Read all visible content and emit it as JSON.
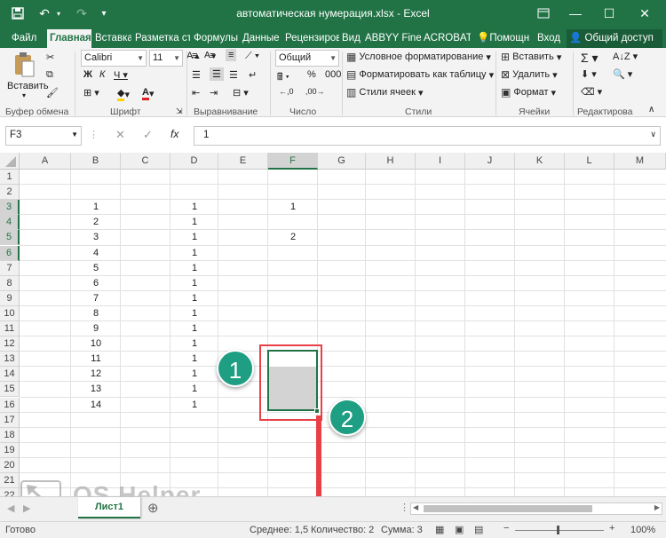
{
  "title": "автоматическая нумерация.xlsx - Excel",
  "tabs": [
    "Файл",
    "Главная",
    "Вставка",
    "Разметка стр",
    "Формулы",
    "Данные",
    "Рецензиров",
    "Вид",
    "ABBYY FineR",
    "ACROBAT",
    "Помощн",
    "Вход",
    "Общий доступ"
  ],
  "ribbon": {
    "paste": "Вставить",
    "font_name": "Calibri",
    "font_size": "11",
    "number_format": "Общий",
    "cond_format": "Условное форматирование",
    "format_table": "Форматировать как таблицу",
    "cell_styles": "Стили ячеек",
    "insert": "Вставить",
    "delete": "Удалить",
    "format": "Формат",
    "groups": [
      "Буфер обмена",
      "Шрифт",
      "Выравнивание",
      "Число",
      "Стили",
      "Ячейки",
      "Редактирова"
    ]
  },
  "formula_bar": {
    "name_box": "F3",
    "formula": "1"
  },
  "columns": [
    "A",
    "B",
    "C",
    "D",
    "E",
    "F",
    "G",
    "H",
    "I",
    "J",
    "K",
    "L",
    "M"
  ],
  "rows": [
    "1",
    "2",
    "3",
    "4",
    "5",
    "6",
    "7",
    "8",
    "9",
    "10",
    "11",
    "12",
    "13",
    "14",
    "15",
    "16",
    "17",
    "18",
    "19",
    "20",
    "21",
    "22"
  ],
  "col_b": [
    "1",
    "2",
    "3",
    "4",
    "5",
    "6",
    "7",
    "8",
    "9",
    "10",
    "11",
    "12",
    "13",
    "14"
  ],
  "col_d": [
    "1",
    "1",
    "1",
    "1",
    "1",
    "1",
    "1",
    "1",
    "1",
    "1",
    "1",
    "1",
    "1",
    "1"
  ],
  "col_f": [
    "1",
    "2"
  ],
  "annotations": {
    "step1": "1",
    "step2": "2"
  },
  "watermark": "OS Helper",
  "sheet_tab": "Лист1",
  "status": {
    "ready": "Готово",
    "average": "Среднее: 1,5",
    "count": "Количество: 2",
    "sum": "Сумма: 3",
    "zoom": "100%"
  },
  "colors": {
    "accent": "#217346",
    "badge": "#1e9e83",
    "highlight": "#e84046"
  }
}
